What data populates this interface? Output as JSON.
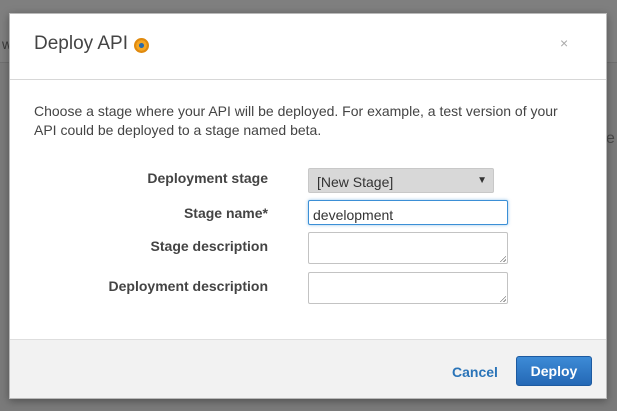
{
  "background": {
    "left_fragment": "w",
    "right_fragment": "e"
  },
  "dialog": {
    "title": "Deploy API",
    "title_icon": "info-icon",
    "close_label": "×",
    "intro": "Choose a stage where your API will be deployed. For example, a test version of your API could be deployed to a stage named beta.",
    "fields": {
      "deployment_stage": {
        "label": "Deployment stage",
        "value": "[New Stage]"
      },
      "stage_name": {
        "label": "Stage name*",
        "value": "development"
      },
      "stage_description": {
        "label": "Stage description",
        "value": ""
      },
      "deployment_description": {
        "label": "Deployment description",
        "value": ""
      }
    },
    "footer": {
      "cancel_label": "Cancel",
      "deploy_label": "Deploy"
    }
  },
  "colors": {
    "primary_button": "#2a74b8",
    "link": "#2a74b8",
    "focus_border": "#3b8fd6",
    "icon_orange": "#f5a623"
  }
}
